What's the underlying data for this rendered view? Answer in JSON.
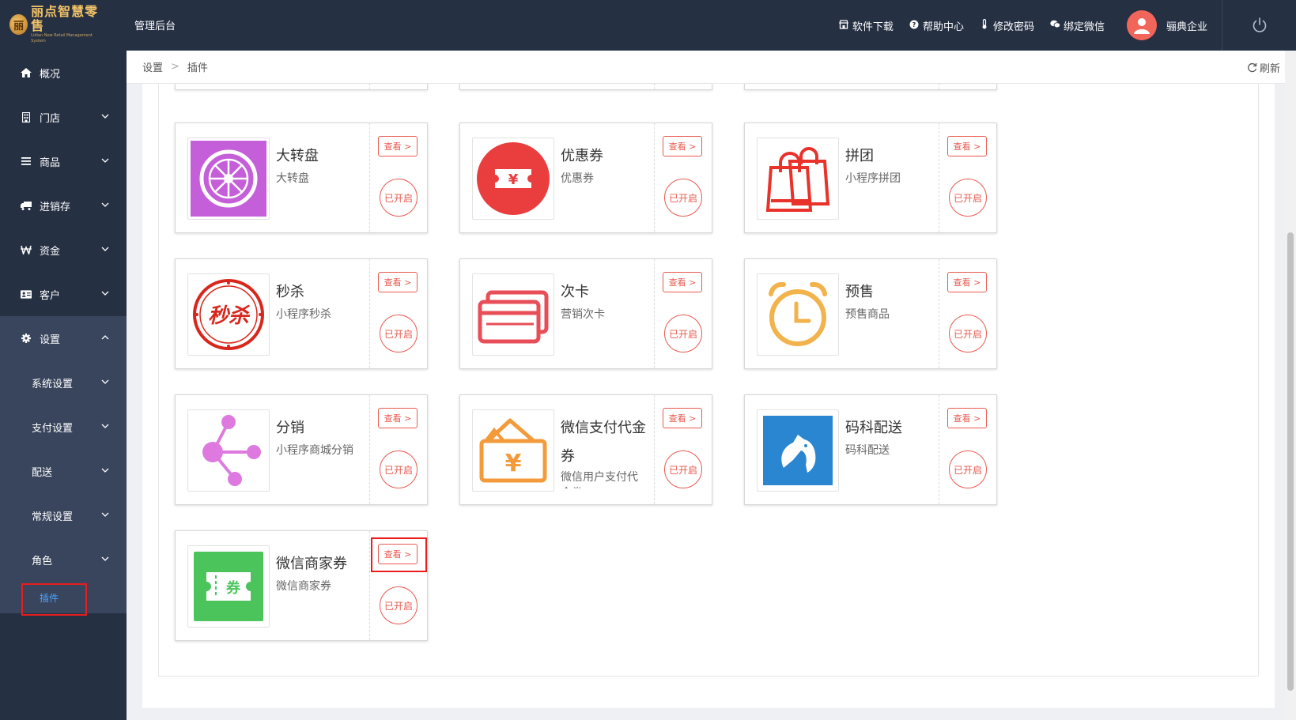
{
  "header": {
    "brand_name": "丽点智慧零售",
    "brand_tagline": "Lidian New Retail Management System",
    "title": "管理后台",
    "links": [
      {
        "label": "软件下载",
        "icon": "store-icon"
      },
      {
        "label": "帮助中心",
        "icon": "help-icon"
      },
      {
        "label": "修改密码",
        "icon": "thermometer-icon"
      },
      {
        "label": "绑定微信",
        "icon": "wechat-icon"
      }
    ],
    "user_name": "骊典企业"
  },
  "sidebar": {
    "items": [
      {
        "label": "概况",
        "icon": "home-icon"
      },
      {
        "label": "门店",
        "icon": "store-icon"
      },
      {
        "label": "商品",
        "icon": "list-icon"
      },
      {
        "label": "进销存",
        "icon": "truck-icon"
      },
      {
        "label": "资金",
        "icon": "won-icon"
      },
      {
        "label": "客户",
        "icon": "id-card-icon"
      },
      {
        "label": "设置",
        "icon": "gear-icon"
      }
    ],
    "sub_items": [
      {
        "label": "系统设置"
      },
      {
        "label": "支付设置"
      },
      {
        "label": "配送"
      },
      {
        "label": "常规设置"
      },
      {
        "label": "角色"
      }
    ],
    "active_leaf": "插件"
  },
  "breadcrumb": {
    "items": [
      "设置",
      "插件"
    ],
    "refresh_label": "刷新"
  },
  "plugins": [
    {
      "name": "大转盘",
      "desc": "大转盘",
      "icon": "wheel-icon",
      "color": "#c45fd9"
    },
    {
      "name": "优惠券",
      "desc": "优惠券",
      "icon": "coupon-icon",
      "color": "#ea3e3e"
    },
    {
      "name": "拼团",
      "desc": "小程序拼团",
      "icon": "shopping-bag-icon",
      "color": "#e8322a"
    },
    {
      "name": "秒杀",
      "desc": "小程序秒杀",
      "icon": "flash-sale-icon",
      "color": "#d9261c"
    },
    {
      "name": "次卡",
      "desc": "营销次卡",
      "icon": "card-icon",
      "color": "#e84e57"
    },
    {
      "name": "预售",
      "desc": "预售商品",
      "icon": "alarm-clock-icon",
      "color": "#f2b24c"
    },
    {
      "name": "分销",
      "desc": "小程序商城分销",
      "icon": "share-nodes-icon",
      "color": "#de7adf"
    },
    {
      "name": "微信支付代金券",
      "desc": "微信用户支付代金券",
      "icon": "wallet-icon",
      "color": "#f39a3a"
    },
    {
      "name": "码科配送",
      "desc": "码科配送",
      "icon": "horse-icon",
      "color": "#2a86d0"
    },
    {
      "name": "微信商家券",
      "desc": "微信商家券",
      "icon": "ticket-icon",
      "color": "#4cc45c"
    }
  ],
  "card_labels": {
    "view": "查看",
    "enabled": "已开启"
  }
}
